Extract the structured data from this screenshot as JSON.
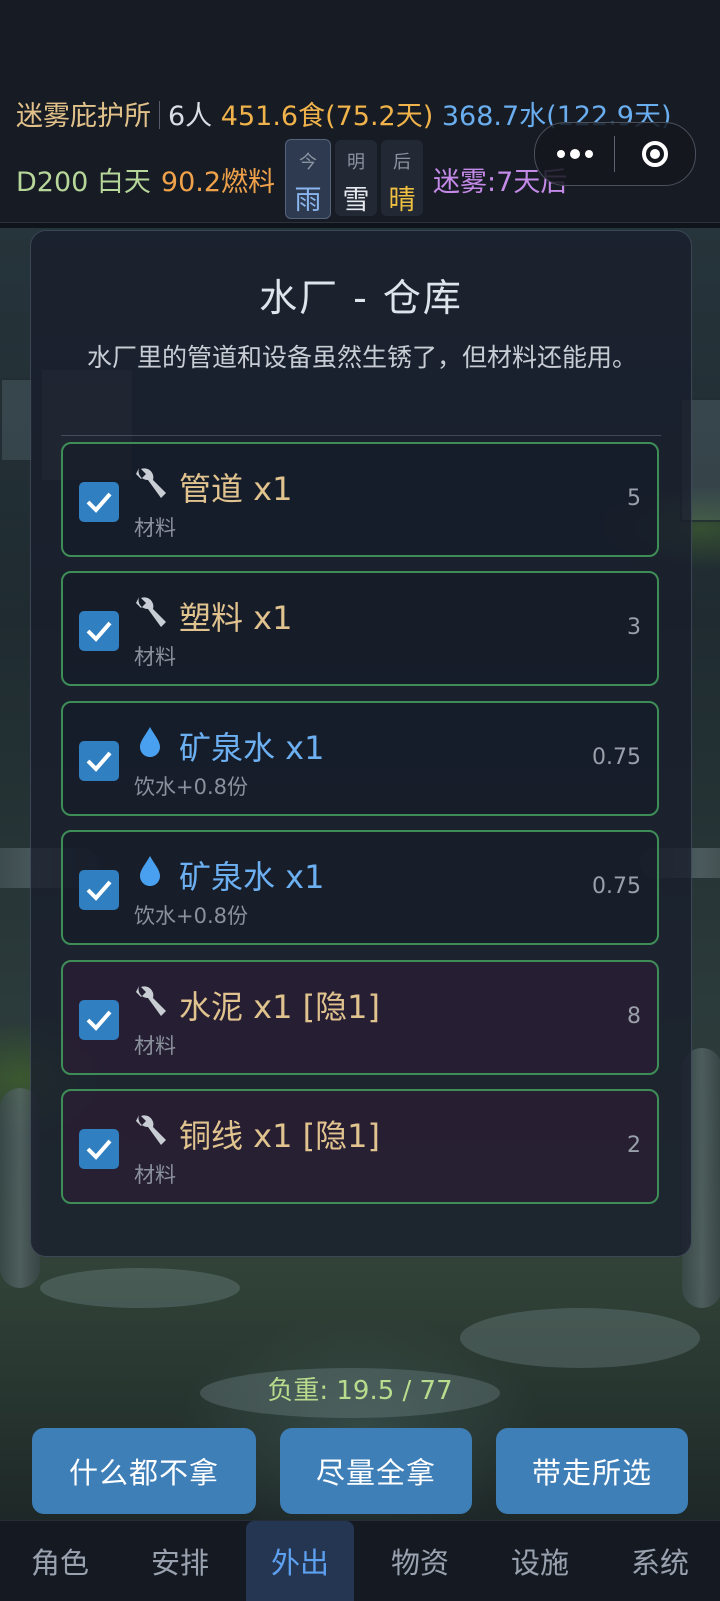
{
  "header": {
    "shelter_name": "迷雾庇护所",
    "people": "6人",
    "food": "451.6食(75.2天)",
    "water": "368.7水(122.9天)",
    "day": "D200 白天",
    "fuel": "90.2燃料",
    "weather": [
      {
        "label": "今",
        "value": "雨"
      },
      {
        "label": "明",
        "value": "雪"
      },
      {
        "label": "后",
        "value": "晴"
      }
    ],
    "fog": "迷雾:7天后"
  },
  "panel": {
    "title": "水厂 - 仓库",
    "description": "水厂里的管道和设备虽然生锈了，但材料还能用。",
    "items": [
      {
        "icon": "wrench-icon",
        "name": "管道 x1",
        "sub": "材料",
        "weight": "5",
        "checked": true
      },
      {
        "icon": "wrench-icon",
        "name": "塑料 x1",
        "sub": "材料",
        "weight": "3",
        "checked": true
      },
      {
        "icon": "water-drop-icon",
        "name": "矿泉水 x1",
        "sub": "饮水+0.8份",
        "weight": "0.75",
        "checked": true
      },
      {
        "icon": "water-drop-icon",
        "name": "矿泉水 x1",
        "sub": "饮水+0.8份",
        "weight": "0.75",
        "checked": true
      },
      {
        "icon": "wrench-icon",
        "name": "水泥 x1 [隐1]",
        "sub": "材料",
        "weight": "8",
        "checked": true
      },
      {
        "icon": "wrench-icon",
        "name": "铜线 x1 [隐1]",
        "sub": "材料",
        "weight": "2",
        "checked": true
      }
    ]
  },
  "load": "负重: 19.5 / 77",
  "buttons": {
    "take_nothing": "什么都不拿",
    "take_all": "尽量全拿",
    "take_selected": "带走所选"
  },
  "tabs": [
    "角色",
    "安排",
    "外出",
    "物资",
    "设施",
    "系统"
  ],
  "active_tab": "外出",
  "colors": {
    "accent": "#3f7fb8",
    "checkbox": "#2f7fc1",
    "item_border": "#3e8d57"
  }
}
